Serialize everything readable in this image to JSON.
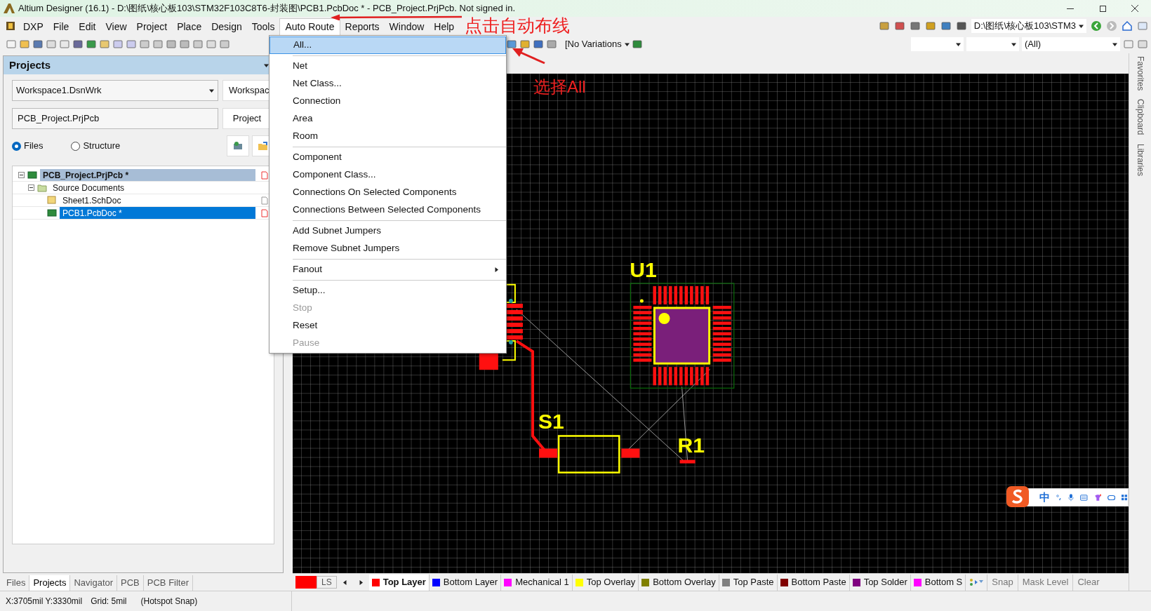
{
  "window": {
    "title": "Altium Designer (16.1) - D:\\图纸\\核心板103\\STM32F103C8T6-封装图\\PCB1.PcbDoc * - PCB_Project.PrjPcb. Not signed in."
  },
  "menu_bar": [
    {
      "label": "DXP",
      "selected": false
    },
    {
      "label": "File",
      "selected": false
    },
    {
      "label": "Edit",
      "selected": false
    },
    {
      "label": "View",
      "selected": false
    },
    {
      "label": "Project",
      "selected": false
    },
    {
      "label": "Place",
      "selected": false
    },
    {
      "label": "Design",
      "selected": false
    },
    {
      "label": "Tools",
      "selected": false
    },
    {
      "label": "Auto Route",
      "selected": true
    },
    {
      "label": "Reports",
      "selected": false
    },
    {
      "label": "Window",
      "selected": false
    },
    {
      "label": "Help",
      "selected": false
    }
  ],
  "toolbar": {
    "variations": "[No Variations",
    "path": "D:\\图纸\\核心板103\\STM3",
    "filter": "(All)"
  },
  "dropdown_menu": [
    {
      "kind": "item",
      "label": "All...",
      "selected": true,
      "disabled": false
    },
    {
      "kind": "separator"
    },
    {
      "kind": "item",
      "label": "Net",
      "selected": false,
      "disabled": false
    },
    {
      "kind": "item",
      "label": "Net Class...",
      "selected": false,
      "disabled": false
    },
    {
      "kind": "item",
      "label": "Connection",
      "selected": false,
      "disabled": false
    },
    {
      "kind": "item",
      "label": "Area",
      "selected": false,
      "disabled": false
    },
    {
      "kind": "item",
      "label": "Room",
      "selected": false,
      "disabled": false
    },
    {
      "kind": "separator"
    },
    {
      "kind": "item",
      "label": "Component",
      "selected": false,
      "disabled": false
    },
    {
      "kind": "item",
      "label": "Component Class...",
      "selected": false,
      "disabled": false
    },
    {
      "kind": "item",
      "label": "Connections On Selected Components",
      "selected": false,
      "disabled": false
    },
    {
      "kind": "item",
      "label": "Connections Between Selected Components",
      "selected": false,
      "disabled": false
    },
    {
      "kind": "separator"
    },
    {
      "kind": "item",
      "label": "Add Subnet Jumpers",
      "selected": false,
      "disabled": false
    },
    {
      "kind": "item",
      "label": "Remove Subnet Jumpers",
      "selected": false,
      "disabled": false
    },
    {
      "kind": "separator"
    },
    {
      "kind": "submenu",
      "label": "Fanout",
      "selected": false,
      "disabled": false
    },
    {
      "kind": "separator"
    },
    {
      "kind": "item",
      "label": "Setup...",
      "selected": false,
      "disabled": false
    },
    {
      "kind": "item",
      "label": "Stop",
      "selected": false,
      "disabled": true
    },
    {
      "kind": "item",
      "label": "Reset",
      "selected": false,
      "disabled": false
    },
    {
      "kind": "item",
      "label": "Pause",
      "selected": false,
      "disabled": true
    }
  ],
  "annotations": [
    {
      "text": "点击自动布线"
    },
    {
      "text": "选择All"
    }
  ],
  "projects_panel": {
    "title": "Projects",
    "workspace": "Workspace1.DsnWrk",
    "workspace_button": "Workspac",
    "project": "PCB_Project.PrjPcb",
    "project_button": "Project",
    "view_options": [
      {
        "label": "Files",
        "selected": true
      },
      {
        "label": "Structure",
        "selected": false
      }
    ],
    "tree": [
      {
        "label": "PCB_Project.PrjPcb *",
        "kind": "project",
        "selected": false,
        "expanded": true,
        "children": [
          {
            "label": "Source Documents",
            "kind": "folder",
            "selected": false,
            "expanded": true,
            "children": [
              {
                "label": "Sheet1.SchDoc",
                "kind": "schematic",
                "selected": false
              },
              {
                "label": "PCB1.PcbDoc *",
                "kind": "pcb",
                "selected": true
              }
            ]
          }
        ]
      }
    ],
    "tabs": [
      {
        "label": "Files",
        "selected": false
      },
      {
        "label": "Projects",
        "selected": true
      },
      {
        "label": "Navigator",
        "selected": false
      },
      {
        "label": "PCB",
        "selected": false
      },
      {
        "label": "PCB Filter",
        "selected": false
      }
    ]
  },
  "canvas": {
    "labels": [
      "U1",
      "S1",
      "R1"
    ]
  },
  "side_tabs": [
    "Favorites",
    "Clipboard",
    "Libraries"
  ],
  "layer_bar": {
    "current": "LS",
    "layers": [
      {
        "label": "Top Layer",
        "color": "#ff0000",
        "selected": true
      },
      {
        "label": "Bottom Layer",
        "color": "#0000ff",
        "selected": false
      },
      {
        "label": "Mechanical 1",
        "color": "#ff00ff",
        "selected": false
      },
      {
        "label": "Top Overlay",
        "color": "#ffff00",
        "selected": false
      },
      {
        "label": "Bottom Overlay",
        "color": "#808000",
        "selected": false
      },
      {
        "label": "Top Paste",
        "color": "#808080",
        "selected": false
      },
      {
        "label": "Bottom Paste",
        "color": "#800000",
        "selected": false
      },
      {
        "label": "Top Solder",
        "color": "#800080",
        "selected": false
      },
      {
        "label": "Bottom S",
        "color": "#ff00ff",
        "selected": false
      }
    ],
    "buttons": [
      "Snap",
      "Mask Level",
      "Clear"
    ]
  },
  "ime_toolbar": {
    "mode": "中"
  },
  "status_bar": [
    "X:3705mil Y:3330mil",
    "Grid: 5mil",
    "(Hotspot Snap)"
  ]
}
